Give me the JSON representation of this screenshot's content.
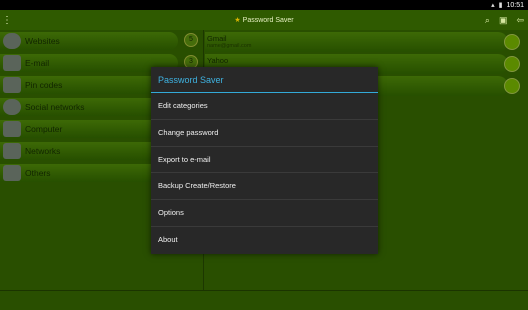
{
  "status_bar": {
    "time": "10:51"
  },
  "action_bar": {
    "title": "Password Saver"
  },
  "categories": [
    {
      "label": "Websites",
      "count": "5"
    },
    {
      "label": "E-mail",
      "count": "3"
    },
    {
      "label": "Pin codes",
      "count": ""
    },
    {
      "label": "Social networks",
      "count": ""
    },
    {
      "label": "Computer",
      "count": ""
    },
    {
      "label": "Networks",
      "count": ""
    },
    {
      "label": "Others",
      "count": ""
    }
  ],
  "entries": [
    {
      "title": "Gmail",
      "subtitle": "name@gmail.com"
    },
    {
      "title": "Yahoo",
      "subtitle": ""
    },
    {
      "title": "",
      "subtitle": ""
    }
  ],
  "dialog": {
    "title": "Password Saver",
    "items": [
      "Edit categories",
      "Change password",
      "Export to e-mail",
      "Backup Create/Restore",
      "Options",
      "About"
    ]
  },
  "colors": {
    "accent": "#3fb2e0",
    "background": "#3f7a00",
    "action_bar": "#2f5a00"
  }
}
